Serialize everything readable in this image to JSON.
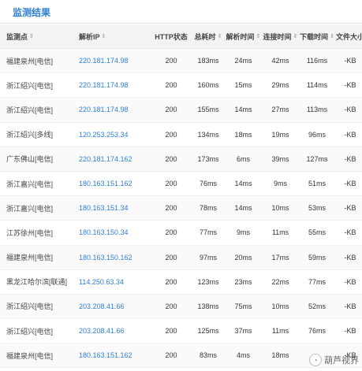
{
  "title": "监测结果",
  "headers": [
    "监测点",
    "解析IP",
    "HTTP状态",
    "总耗时",
    "解析时间",
    "连接时间",
    "下载时间",
    "文件大小"
  ],
  "sortable": [
    true,
    true,
    false,
    true,
    true,
    true,
    true,
    false
  ],
  "sort_glyph": "⇕",
  "rows": [
    [
      "福建泉州[电信]",
      "220.181.174.98",
      "200",
      "183ms",
      "24ms",
      "42ms",
      "116ms",
      "-KB"
    ],
    [
      "浙江绍兴[电信]",
      "220.181.174.98",
      "200",
      "160ms",
      "15ms",
      "29ms",
      "114ms",
      "-KB"
    ],
    [
      "浙江绍兴[电信]",
      "220.181.174.98",
      "200",
      "155ms",
      "14ms",
      "27ms",
      "113ms",
      "-KB"
    ],
    [
      "浙江绍兴[多线]",
      "120.253.253.34",
      "200",
      "134ms",
      "18ms",
      "19ms",
      "96ms",
      "-KB"
    ],
    [
      "广东佛山[电信]",
      "220.181.174.162",
      "200",
      "173ms",
      "6ms",
      "39ms",
      "127ms",
      "-KB"
    ],
    [
      "浙江嘉兴[电信]",
      "180.163.151.162",
      "200",
      "76ms",
      "14ms",
      "9ms",
      "51ms",
      "-KB"
    ],
    [
      "浙江嘉兴[电信]",
      "180.163.151.34",
      "200",
      "78ms",
      "14ms",
      "10ms",
      "53ms",
      "-KB"
    ],
    [
      "江苏徐州[电信]",
      "180.163.150.34",
      "200",
      "77ms",
      "9ms",
      "11ms",
      "55ms",
      "-KB"
    ],
    [
      "福建泉州[电信]",
      "180.163.150.162",
      "200",
      "97ms",
      "20ms",
      "17ms",
      "59ms",
      "-KB"
    ],
    [
      "黑龙江哈尔滨[联通]",
      "114.250.63.34",
      "200",
      "123ms",
      "23ms",
      "22ms",
      "77ms",
      "-KB"
    ],
    [
      "浙江绍兴[电信]",
      "203.208.41.66",
      "200",
      "138ms",
      "75ms",
      "10ms",
      "52ms",
      "-KB"
    ],
    [
      "浙江绍兴[电信]",
      "203.208.41.66",
      "200",
      "125ms",
      "37ms",
      "11ms",
      "76ms",
      "-KB"
    ],
    [
      "福建泉州[电信]",
      "180.163.151.162",
      "200",
      "83ms",
      "4ms",
      "18ms",
      "",
      "-KB"
    ]
  ],
  "watermark": "葫芦视界"
}
